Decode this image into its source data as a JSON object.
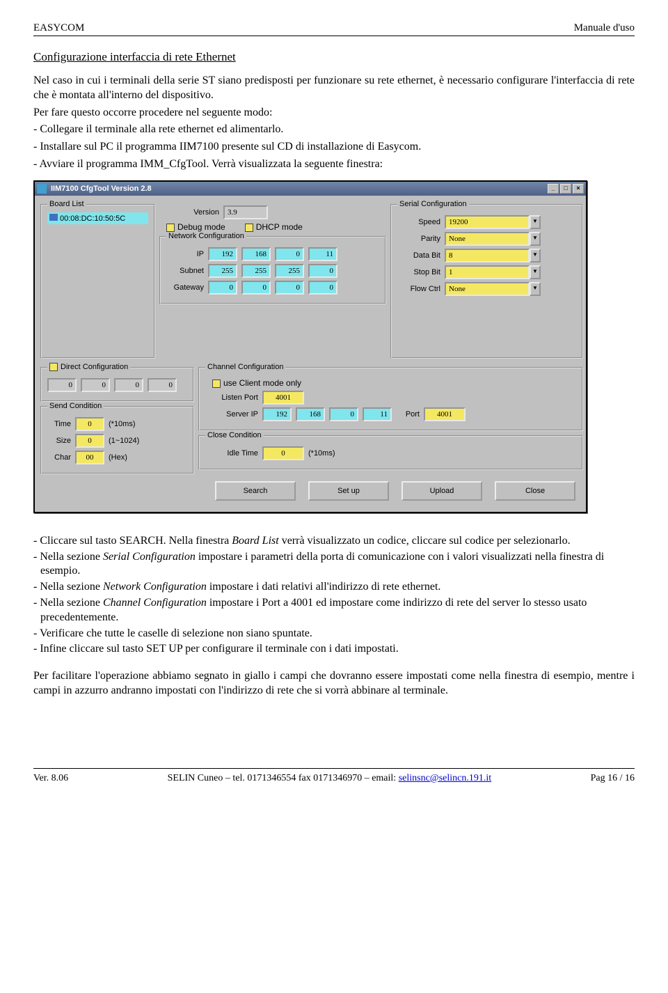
{
  "header": {
    "left": "EASYCOM",
    "right": "Manuale d'uso"
  },
  "title": "Configurazione interfaccia di rete Ethernet",
  "intro": "Nel caso in cui i terminali della serie ST siano predisposti per funzionare su rete ethernet, è necessario configurare l'interfaccia di rete che è montata all'interno del dispositivo.",
  "intro2": "Per fare questo occorre procedere nel seguente modo:",
  "steps_top": [
    "- Collegare il terminale alla rete ethernet ed alimentarlo.",
    "- Installare sul PC il programma IIM7100 presente sul CD di installazione di Easycom.",
    "- Avviare il programma IMM_CfgTool. Verrà visualizzata la seguente finestra:"
  ],
  "window": {
    "title": "IIM7100 CfgTool Version 2.8",
    "board_list": {
      "legend": "Board List",
      "item": "00:08:DC:10:50:5C"
    },
    "version_label": "Version",
    "version": "3.9",
    "debug_label": "Debug mode",
    "dhcp_label": "DHCP mode",
    "netcfg": {
      "legend": "Network Configuration",
      "ip_label": "IP",
      "ip": [
        "192",
        "168",
        "0",
        "11"
      ],
      "subnet_label": "Subnet",
      "subnet": [
        "255",
        "255",
        "255",
        "0"
      ],
      "gateway_label": "Gateway",
      "gateway": [
        "0",
        "0",
        "0",
        "0"
      ]
    },
    "serial": {
      "legend": "Serial Configuration",
      "speed_label": "Speed",
      "speed": "19200",
      "parity_label": "Parity",
      "parity": "None",
      "databit_label": "Data Bit",
      "databit": "8",
      "stopbit_label": "Stop Bit",
      "stopbit": "1",
      "flow_label": "Flow Ctrl",
      "flow": "None"
    },
    "direct": {
      "legend": "Direct Configuration",
      "vals": [
        "0",
        "0",
        "0",
        "0"
      ]
    },
    "send": {
      "legend": "Send Condition",
      "time_label": "Time",
      "time": "0",
      "time_suffix": "(*10ms)",
      "size_label": "Size",
      "size": "0",
      "size_suffix": "(1~1024)",
      "char_label": "Char",
      "char": "00",
      "char_suffix": "(Hex)"
    },
    "channel": {
      "legend": "Channel Configuration",
      "client_label": "use Client mode only",
      "listen_label": "Listen Port",
      "listen": "4001",
      "serverip_label": "Server IP",
      "serverip": [
        "192",
        "168",
        "0",
        "11"
      ],
      "port_label": "Port",
      "port": "4001"
    },
    "close": {
      "legend": "Close Condition",
      "idle_label": "Idle Time",
      "idle": "0",
      "idle_suffix": "(*10ms)"
    },
    "buttons": {
      "search": "Search",
      "setup": "Set up",
      "upload": "Upload",
      "close": "Close"
    }
  },
  "steps_bottom": [
    {
      "pre": "- Cliccare sul tasto SEARCH. Nella finestra ",
      "ital": "Board List",
      "post": " verrà visualizzato un codice, cliccare sul codice per selezionarlo."
    },
    {
      "pre": "- Nella sezione ",
      "ital": "Serial Configuration",
      "post": " impostare i parametri della porta di comunicazione con i valori visualizzati nella finestra di esempio."
    },
    {
      "pre": "- Nella sezione ",
      "ital": "Network Configuration",
      "post": " impostare i dati relativi all'indirizzo di rete ethernet."
    },
    {
      "pre": "- Nella sezione ",
      "ital": "Channel Configuration",
      "post": " impostare i Port a 4001 ed impostare come indirizzo di rete del server lo stesso usato precedentemente."
    },
    {
      "pre": "- Verificare che tutte le caselle di selezione non siano spuntate.",
      "ital": "",
      "post": ""
    },
    {
      "pre": "- Infine cliccare  sul tasto SET UP per configurare il terminale con i dati impostati.",
      "ital": "",
      "post": ""
    }
  ],
  "closing": "Per facilitare l'operazione abbiamo segnato in giallo i campi che dovranno essere impostati come nella finestra di esempio, mentre i campi in azzurro andranno impostati con l'indirizzo di rete che si vorrà abbinare al terminale.",
  "footer": {
    "ver": "Ver. 8.06",
    "mid_pre": "SELIN Cuneo – tel. 0171346554 fax 0171346970 – email: ",
    "email": "selinsnc@selincn.191.it",
    "page": "Pag  16 / 16"
  }
}
